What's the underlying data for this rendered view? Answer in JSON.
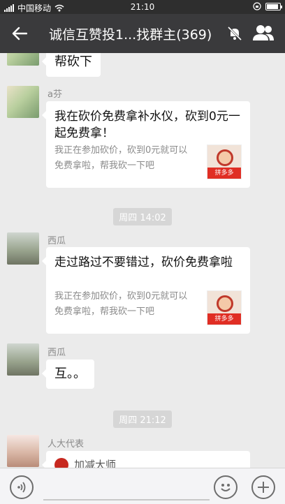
{
  "status_bar": {
    "carrier": "中国移动",
    "time": "21:10",
    "battery_level": 0.8
  },
  "header": {
    "title": "诚信互赞投1...找群主(369)"
  },
  "messages": [
    {
      "type": "text",
      "text": "帮砍下"
    },
    {
      "type": "card",
      "sender": "a芬",
      "title": "我在砍价免费拿补水仪，砍到0元一起免费拿！",
      "desc": "我正在参加砍价，砍到0元就可以免费拿啦，帮我砍一下吧",
      "app": "拼多多"
    },
    {
      "type": "time",
      "text": "周四 14:02"
    },
    {
      "type": "card",
      "sender": "西瓜",
      "title": "走过路过不要错过，砍价免费拿啦",
      "desc": "我正在参加砍价，砍到0元就可以免费拿啦，帮我砍一下吧",
      "app": "拼多多"
    },
    {
      "type": "text",
      "sender": "西瓜",
      "text": "互。。"
    },
    {
      "type": "time",
      "text": "周四 21:12"
    },
    {
      "type": "card",
      "sender": "人大代表",
      "title": "加减大师"
    }
  ],
  "icons": {
    "back": "back-arrow-icon",
    "mute": "mute-bell-icon",
    "members": "group-members-icon",
    "voice": "voice-icon",
    "emoji": "emoji-icon",
    "plus": "plus-icon"
  }
}
